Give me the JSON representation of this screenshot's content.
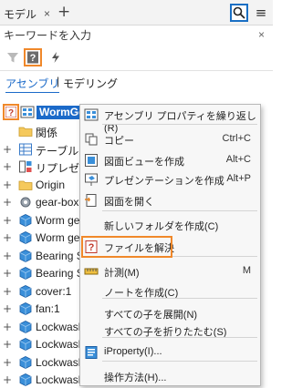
{
  "panel": {
    "tab_label": "モデル",
    "close_glyph": "×",
    "new_tab_glyph": "+"
  },
  "search": {
    "placeholder": "キーワードを入力",
    "clear_glyph": "×"
  },
  "view_tabs": {
    "assembly": "アセンブリ",
    "separator": "|",
    "modeling": "モデリング"
  },
  "tree": {
    "root": "WormGe",
    "items": [
      {
        "label": "関係",
        "icon": "folder-icon",
        "expand": ""
      },
      {
        "label": "テーブル",
        "icon": "table-icon",
        "expand": "+"
      },
      {
        "label": "リプレゼンテ",
        "icon": "representations-icon",
        "expand": "+"
      },
      {
        "label": "Origin",
        "icon": "folder-icon",
        "expand": "+"
      },
      {
        "label": "gear-box.i",
        "icon": "gear-box-icon",
        "expand": "+"
      },
      {
        "label": "Worm gea",
        "icon": "part-icon",
        "expand": "+"
      },
      {
        "label": "Worm gea",
        "icon": "part-icon",
        "expand": "+"
      },
      {
        "label": "Bearing S",
        "icon": "part-icon",
        "expand": "+"
      },
      {
        "label": "Bearing S",
        "icon": "part-icon",
        "expand": "+"
      },
      {
        "label": "cover:1",
        "icon": "part-icon",
        "expand": "+"
      },
      {
        "label": "fan:1",
        "icon": "part-icon",
        "expand": "+"
      },
      {
        "label": "Lockwash",
        "icon": "part-icon",
        "expand": "+"
      },
      {
        "label": "Lockwash",
        "icon": "part-icon",
        "expand": "+"
      },
      {
        "label": "Lockwash",
        "icon": "part-icon",
        "expand": "+"
      },
      {
        "label": "Lockwash",
        "icon": "part-icon",
        "expand": "+"
      }
    ]
  },
  "context_menu": {
    "items": [
      {
        "label": "アセンブリ プロパティを繰り返し(R)",
        "shortcut": "",
        "icon": "assembly-properties-icon"
      },
      {
        "label": "コピー",
        "shortcut": "Ctrl+C",
        "icon": "copy-icon"
      },
      {
        "label": "図面ビューを作成",
        "shortcut": "Alt+C",
        "icon": "drawing-view-icon"
      },
      {
        "label": "プレゼンテーションを作成",
        "shortcut": "Alt+P",
        "icon": "presentation-icon"
      },
      {
        "label": "図面を開く",
        "shortcut": "",
        "icon": "open-drawing-icon"
      },
      {
        "label": "新しいフォルダを作成(C)",
        "shortcut": "",
        "icon": ""
      },
      {
        "label": "ファイルを解決",
        "shortcut": "",
        "icon": "resolve-file-icon"
      },
      {
        "label": "計測(M)",
        "shortcut": "M",
        "icon": "measure-icon"
      },
      {
        "label": "ノートを作成(C)",
        "shortcut": "",
        "icon": ""
      },
      {
        "label": "すべての子を展開(N)",
        "shortcut": "",
        "icon": ""
      },
      {
        "label": "すべての子を折りたたむ(S)",
        "shortcut": "",
        "icon": ""
      },
      {
        "label": "iProperty(I)...",
        "shortcut": "",
        "icon": "iproperty-icon"
      },
      {
        "label": "操作方法(H)...",
        "shortcut": "",
        "icon": ""
      }
    ]
  },
  "colors": {
    "accent": "#1b6ac9",
    "highlight": "#f0882a",
    "selection": "#1b6ac9",
    "folder": "#f5c95c",
    "part": "#3a8fd9"
  }
}
